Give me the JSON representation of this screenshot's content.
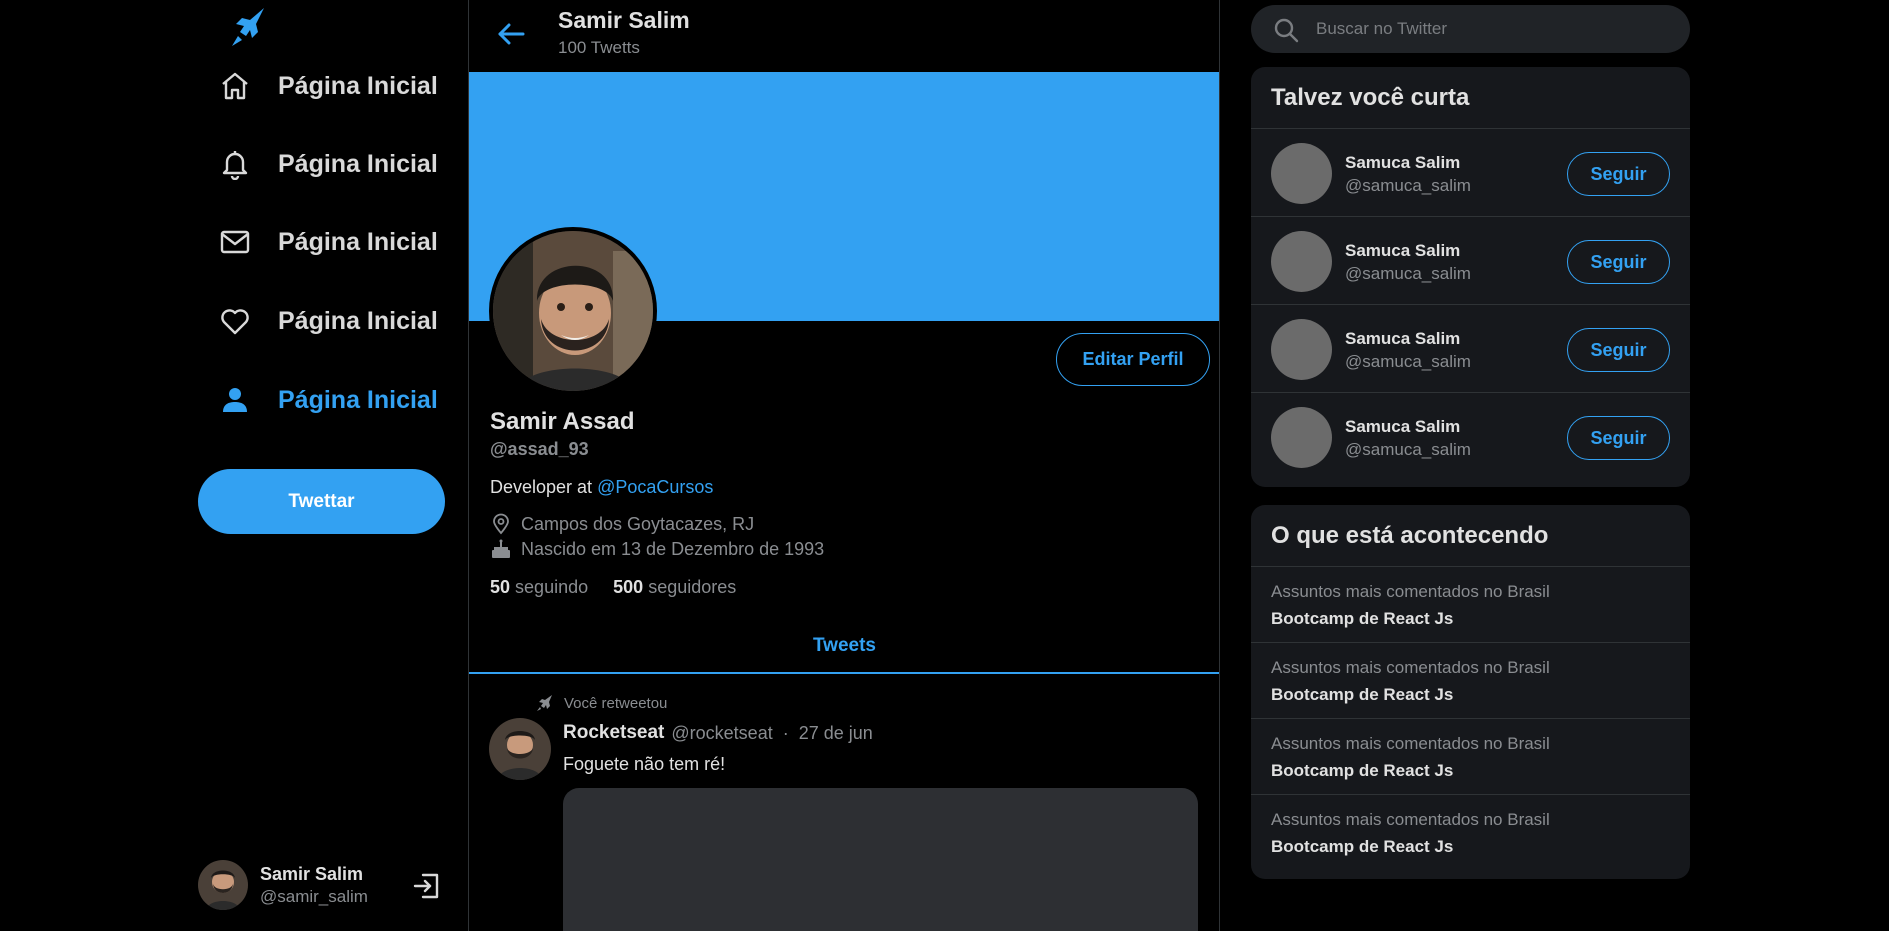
{
  "colors": {
    "accent": "#33a1f2",
    "background": "#000000",
    "panel": "#16181c",
    "muted": "#8a8d91"
  },
  "nav": {
    "items": [
      {
        "icon": "home-icon",
        "label": "Página Inicial",
        "active": false
      },
      {
        "icon": "bell-icon",
        "label": "Página Inicial",
        "active": false
      },
      {
        "icon": "mail-icon",
        "label": "Página Inicial",
        "active": false
      },
      {
        "icon": "heart-icon",
        "label": "Página Inicial",
        "active": false
      },
      {
        "icon": "person-icon",
        "label": "Página Inicial",
        "active": true
      }
    ],
    "tweet_button": "Twettar"
  },
  "current_user": {
    "name": "Samir Salim",
    "handle": "@samir_salim"
  },
  "header": {
    "title": "Samir Salim",
    "subtitle": "100 Twetts"
  },
  "profile": {
    "name": "Samir Assad",
    "handle": "@assad_93",
    "bio_prefix": "Developer at ",
    "bio_link": "@PocaCursos",
    "location": "Campos dos Goytacazes, RJ",
    "birthday": "Nascido em 13 de Dezembro de 1993",
    "following_count": "50",
    "following_label": "seguindo",
    "followers_count": "500",
    "followers_label": "seguidores",
    "edit_button": "Editar Perfil"
  },
  "tabs": {
    "active": "Tweets"
  },
  "tweet": {
    "retweet_label": "Você retweetou",
    "author": "Rocketseat",
    "handle": "@rocketseat",
    "separator": "·",
    "date": "27 de jun",
    "text": "Foguete não tem ré!"
  },
  "search": {
    "placeholder": "Buscar no Twitter"
  },
  "who_to_follow": {
    "title": "Talvez você curta",
    "items": [
      {
        "name": "Samuca Salim",
        "handle": "@samuca_salim",
        "button": "Seguir"
      },
      {
        "name": "Samuca Salim",
        "handle": "@samuca_salim",
        "button": "Seguir"
      },
      {
        "name": "Samuca Salim",
        "handle": "@samuca_salim",
        "button": "Seguir"
      },
      {
        "name": "Samuca Salim",
        "handle": "@samuca_salim",
        "button": "Seguir"
      }
    ]
  },
  "trends": {
    "title": "O que está acontecendo",
    "items": [
      {
        "context": "Assuntos mais comentados no Brasil",
        "topic": "Bootcamp de React Js"
      },
      {
        "context": "Assuntos mais comentados no Brasil",
        "topic": "Bootcamp de React Js"
      },
      {
        "context": "Assuntos mais comentados no Brasil",
        "topic": "Bootcamp de React Js"
      },
      {
        "context": "Assuntos mais comentados no Brasil",
        "topic": "Bootcamp de React Js"
      }
    ]
  }
}
